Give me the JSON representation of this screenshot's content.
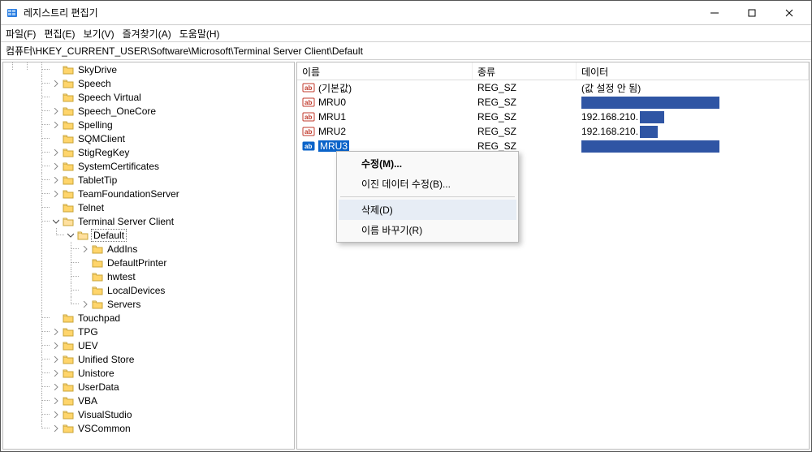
{
  "window": {
    "title": "레지스트리 편집기"
  },
  "menu": {
    "file": "파일(F)",
    "edit": "편집(E)",
    "view": "보기(V)",
    "fav": "즐겨찾기(A)",
    "help": "도움말(H)"
  },
  "address": "컴퓨터\\HKEY_CURRENT_USER\\Software\\Microsoft\\Terminal Server Client\\Default",
  "tree": [
    {
      "label": "SkyDrive",
      "exp": ""
    },
    {
      "label": "Speech",
      "exp": ">"
    },
    {
      "label": "Speech Virtual",
      "exp": ""
    },
    {
      "label": "Speech_OneCore",
      "exp": ">"
    },
    {
      "label": "Spelling",
      "exp": ">"
    },
    {
      "label": "SQMClient",
      "exp": ""
    },
    {
      "label": "StigRegKey",
      "exp": ">"
    },
    {
      "label": "SystemCertificates",
      "exp": ">"
    },
    {
      "label": "TabletTip",
      "exp": ">"
    },
    {
      "label": "TeamFoundationServer",
      "exp": ">"
    },
    {
      "label": "Telnet",
      "exp": ""
    },
    {
      "label": "Terminal Server Client",
      "exp": "v",
      "children": [
        {
          "label": "Default",
          "exp": "v",
          "selected": true,
          "children": [
            {
              "label": "AddIns",
              "exp": ">"
            },
            {
              "label": "DefaultPrinter",
              "exp": ""
            },
            {
              "label": "hwtest",
              "exp": ""
            },
            {
              "label": "LocalDevices",
              "exp": ""
            },
            {
              "label": "Servers",
              "exp": ">"
            }
          ]
        }
      ]
    },
    {
      "label": "Touchpad",
      "exp": ""
    },
    {
      "label": "TPG",
      "exp": ">"
    },
    {
      "label": "UEV",
      "exp": ">"
    },
    {
      "label": "Unified Store",
      "exp": ">"
    },
    {
      "label": "Unistore",
      "exp": ">"
    },
    {
      "label": "UserData",
      "exp": ">"
    },
    {
      "label": "VBA",
      "exp": ">"
    },
    {
      "label": "VisualStudio",
      "exp": ">"
    },
    {
      "label": "VSCommon",
      "exp": ">"
    }
  ],
  "list": {
    "columns": {
      "name": "이름",
      "type": "종류",
      "data": "데이터"
    },
    "rows": [
      {
        "name": "(기본값)",
        "type": "REG_SZ",
        "data_text": "(값 설정 안 됨)"
      },
      {
        "name": "MRU0",
        "type": "REG_SZ",
        "redact": "w1"
      },
      {
        "name": "MRU1",
        "type": "REG_SZ",
        "data_text": "192.168.210.",
        "redact_tail": "w2"
      },
      {
        "name": "MRU2",
        "type": "REG_SZ",
        "data_text": "192.168.210.",
        "redact_tail": "w3"
      },
      {
        "name": "MRU3",
        "type": "REG_SZ",
        "redact": "w4",
        "selected": true
      }
    ]
  },
  "context_menu": {
    "modify": "수정(M)...",
    "modify_binary": "이진 데이터 수정(B)...",
    "delete": "삭제(D)",
    "rename": "이름 바꾸기(R)"
  }
}
